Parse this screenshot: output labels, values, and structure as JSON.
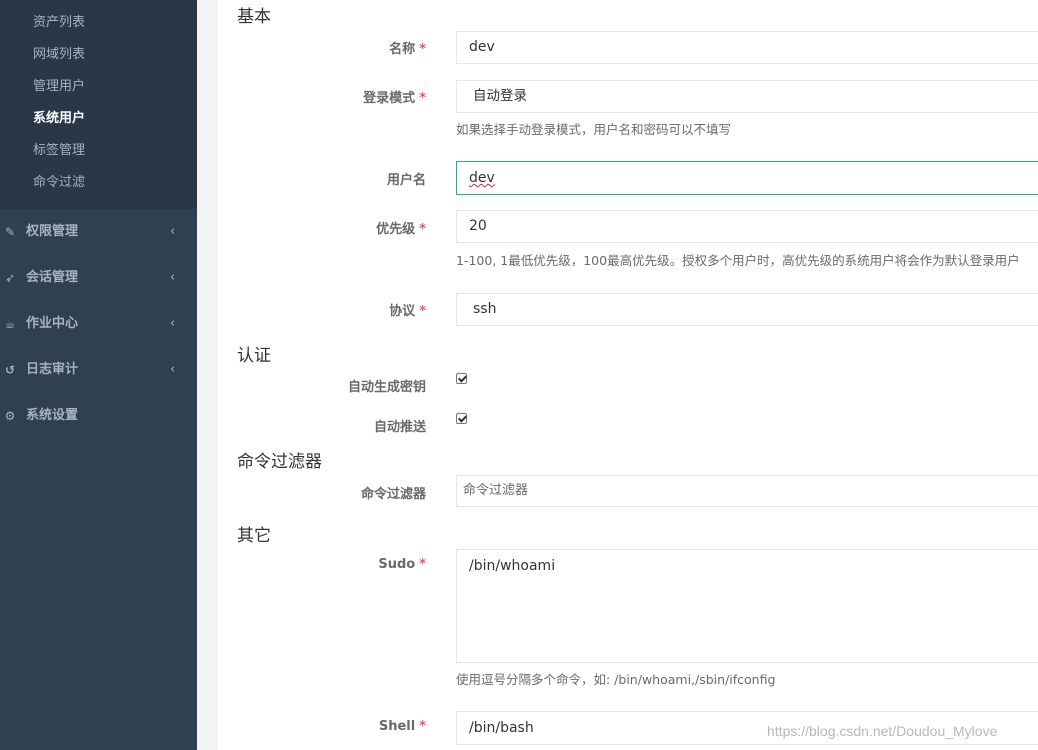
{
  "sidebar": {
    "submenu": [
      {
        "label": "资产列表",
        "active": false
      },
      {
        "label": "网域列表",
        "active": false
      },
      {
        "label": "管理用户",
        "active": false
      },
      {
        "label": "系统用户",
        "active": true
      },
      {
        "label": "标签管理",
        "active": false
      },
      {
        "label": "命令过滤",
        "active": false
      }
    ],
    "nav": [
      {
        "label": "权限管理",
        "icon": "edit-icon",
        "glyph": "✎",
        "chevron": "‹"
      },
      {
        "label": "会话管理",
        "icon": "rocket-icon",
        "glyph": "➶",
        "chevron": "‹"
      },
      {
        "label": "作业中心",
        "icon": "coffee-icon",
        "glyph": "☕",
        "chevron": "‹"
      },
      {
        "label": "日志审计",
        "icon": "history-icon",
        "glyph": "↺",
        "chevron": "‹"
      },
      {
        "label": "系统设置",
        "icon": "gears-icon",
        "glyph": "⚙",
        "chevron": ""
      }
    ]
  },
  "form": {
    "sections": {
      "basic": "基本",
      "auth": "认证",
      "cmd_filter": "命令过滤器",
      "other": "其它"
    },
    "required_mark": "*",
    "name": {
      "label": "名称",
      "value": "dev"
    },
    "login_mode": {
      "label": "登录模式",
      "value": "自动登录",
      "help": "如果选择手动登录模式，用户名和密码可以不填写"
    },
    "username": {
      "label": "用户名",
      "value": "dev"
    },
    "priority": {
      "label": "优先级",
      "value": "20",
      "help": "1-100, 1最低优先级，100最高优先级。授权多个用户时，高优先级的系统用户将会作为默认登录用户"
    },
    "protocol": {
      "label": "协议",
      "value": "ssh"
    },
    "auto_generate_key": {
      "label": "自动生成密钥",
      "checked": true
    },
    "auto_push": {
      "label": "自动推送",
      "checked": true
    },
    "command_filter": {
      "label": "命令过滤器",
      "placeholder": "命令过滤器"
    },
    "sudo": {
      "label": "Sudo",
      "value": "/bin/whoami",
      "help": "使用逗号分隔多个命令，如: /bin/whoami,/sbin/ifconfig"
    },
    "shell": {
      "label": "Shell",
      "value": "/bin/bash"
    }
  },
  "watermark": "https://blog.csdn.net/Doudou_Mylove"
}
